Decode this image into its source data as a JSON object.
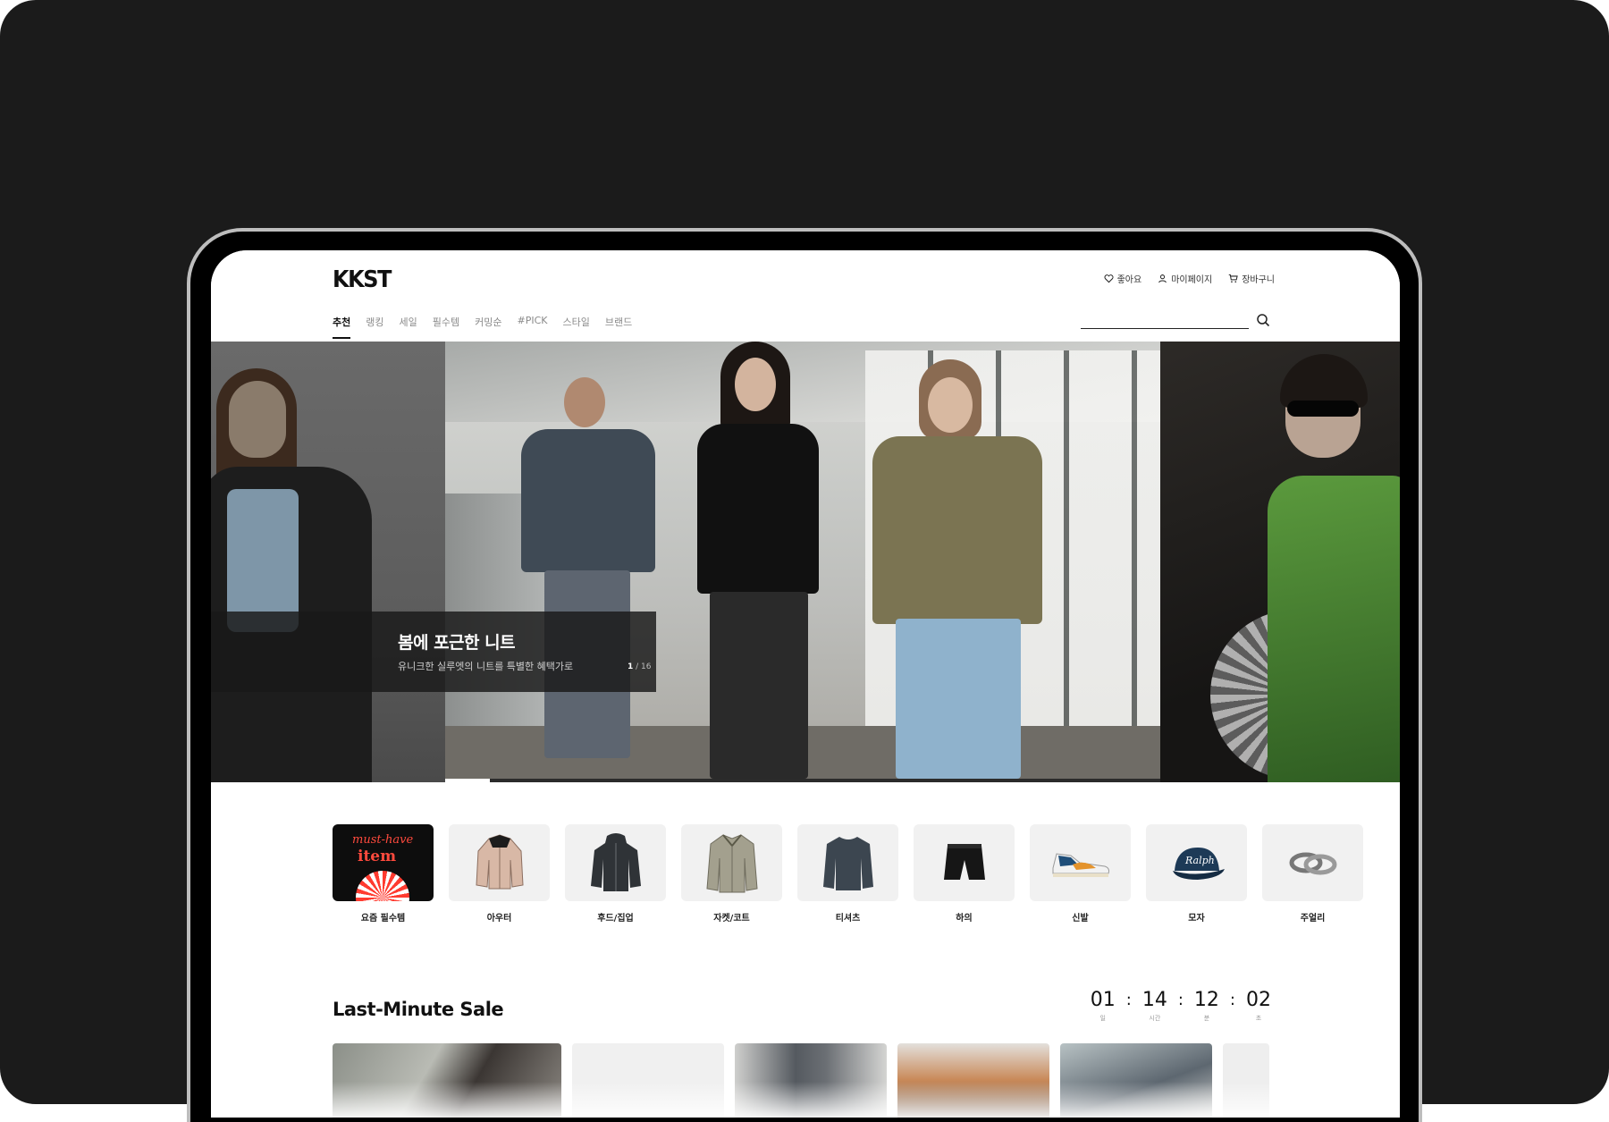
{
  "header": {
    "logo": "KKST",
    "util": [
      {
        "label": "좋아요",
        "icon": "heart-icon"
      },
      {
        "label": "마이페이지",
        "icon": "user-icon"
      },
      {
        "label": "장바구니",
        "icon": "cart-icon"
      }
    ],
    "nav": [
      {
        "label": "추천",
        "active": true
      },
      {
        "label": "랭킹"
      },
      {
        "label": "세일"
      },
      {
        "label": "필수템"
      },
      {
        "label": "커밍순"
      },
      {
        "label": "#PICK"
      },
      {
        "label": "스타일"
      },
      {
        "label": "브랜드"
      }
    ],
    "search": {
      "value": "",
      "placeholder": "",
      "icon": "search-icon"
    }
  },
  "hero": {
    "title": "봄에 포근한 니트",
    "subtitle": "유니크한 실루엣의 니트를 특별한 혜택가로",
    "counter_current": "1",
    "counter_sep": " / ",
    "counter_total": "16",
    "progress": 0.0625
  },
  "categories": [
    {
      "label": "요즘 필수템",
      "icon": "must-have-item-badge",
      "badge_line1": "must-have",
      "badge_line2": "item"
    },
    {
      "label": "아우터",
      "icon": "puffer-jacket-icon"
    },
    {
      "label": "후드/집업",
      "icon": "hoodie-icon"
    },
    {
      "label": "자켓/코트",
      "icon": "jacket-icon"
    },
    {
      "label": "티셔츠",
      "icon": "tshirt-icon"
    },
    {
      "label": "하의",
      "icon": "shorts-icon"
    },
    {
      "label": "신발",
      "icon": "sneaker-icon"
    },
    {
      "label": "모자",
      "icon": "cap-icon"
    },
    {
      "label": "주얼리",
      "icon": "rings-icon"
    }
  ],
  "sale": {
    "title": "Last-Minute Sale",
    "countdown": [
      {
        "value": "01",
        "label": "일"
      },
      {
        "value": "14",
        "label": "시간"
      },
      {
        "value": "12",
        "label": "분"
      },
      {
        "value": "02",
        "label": "초"
      }
    ],
    "separator": ":"
  },
  "colors": {
    "accent": "#111111",
    "background_outer": "#1b1b1b",
    "badge_red": "#ff4a3d",
    "jacket_green": "#5b9a3d"
  }
}
